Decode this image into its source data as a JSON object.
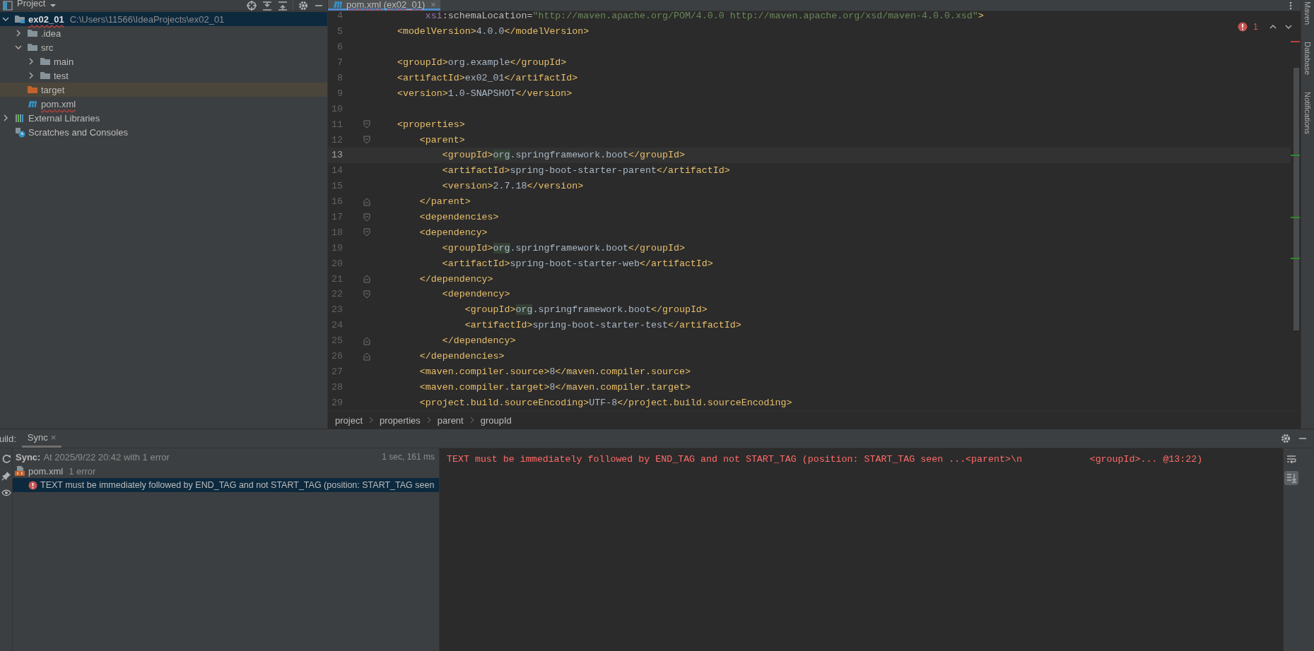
{
  "project_panel": {
    "title": "Project",
    "tree": [
      {
        "kind": "module",
        "label": "ex02_01",
        "path": "C:\\Users\\11566\\IdeaProjects\\ex02_01",
        "expanded": true,
        "selected": true,
        "highlighted": false,
        "has_error": true,
        "children": [
          {
            "kind": "folder",
            "label": ".idea",
            "expanded": false,
            "selected": false,
            "highlighted": false,
            "has_error": false
          },
          {
            "kind": "folder",
            "label": "src",
            "expanded": true,
            "selected": false,
            "highlighted": false,
            "has_error": false,
            "children": [
              {
                "kind": "folder",
                "label": "main",
                "expanded": false,
                "selected": false,
                "highlighted": false,
                "has_error": false
              },
              {
                "kind": "folder",
                "label": "test",
                "expanded": false,
                "selected": false,
                "highlighted": false,
                "has_error": false
              }
            ]
          },
          {
            "kind": "excluded",
            "label": "target",
            "selected": false,
            "highlighted": true,
            "has_error": false
          },
          {
            "kind": "maven",
            "label": "pom.xml",
            "selected": false,
            "highlighted": false,
            "has_error": true
          }
        ]
      },
      {
        "kind": "libraries",
        "label": "External Libraries",
        "expanded": false,
        "selected": false,
        "highlighted": false,
        "has_error": false
      },
      {
        "kind": "scratches",
        "label": "Scratches and Consoles",
        "selected": false,
        "highlighted": false,
        "has_error": false
      }
    ]
  },
  "editor": {
    "tabs": [
      {
        "label": "pom.xml (ex02_01)",
        "close": "×",
        "selected": true,
        "has_error": true
      }
    ],
    "error_count": "1",
    "lines": [
      {
        "number": "4",
        "current": false,
        "tokens": [
          {
            "kind": "ns",
            "text": "         xsi"
          },
          {
            "kind": "attr",
            "text": ":schemaLocation="
          },
          {
            "kind": "string",
            "text": "\"http://maven.apache.org/POM/4.0.0 http://maven.apache.org/xsd/maven-4.0.0.xsd\""
          },
          {
            "kind": "tag",
            "text": ">"
          }
        ]
      },
      {
        "number": "5",
        "current": false,
        "tokens": [
          {
            "kind": "tag",
            "text": "    <modelVersion>"
          },
          {
            "kind": "text",
            "text": "4.0.0"
          },
          {
            "kind": "tag",
            "text": "</modelVersion>"
          }
        ]
      },
      {
        "number": "6",
        "current": false
      },
      {
        "number": "7",
        "current": false,
        "tokens": [
          {
            "kind": "tag",
            "text": "    <groupId>"
          },
          {
            "kind": "text",
            "text": "org.example"
          },
          {
            "kind": "tag",
            "text": "</groupId>"
          }
        ]
      },
      {
        "number": "8",
        "current": false,
        "tokens": [
          {
            "kind": "tag",
            "text": "    <artifactId>"
          },
          {
            "kind": "text",
            "text": "ex02_01"
          },
          {
            "kind": "tag",
            "text": "</artifactId>"
          }
        ]
      },
      {
        "number": "9",
        "current": false,
        "tokens": [
          {
            "kind": "tag",
            "text": "    <version>"
          },
          {
            "kind": "text",
            "text": "1.0-SNAPSHOT"
          },
          {
            "kind": "tag",
            "text": "</version>"
          }
        ]
      },
      {
        "number": "10",
        "current": false
      },
      {
        "number": "11",
        "current": false,
        "kind": "fold-start",
        "tokens": [
          {
            "kind": "tag",
            "text": "    <properties>"
          }
        ]
      },
      {
        "number": "12",
        "current": false,
        "kind": "fold-start",
        "tokens": [
          {
            "kind": "tag",
            "text": "        <parent>"
          }
        ]
      },
      {
        "number": "13",
        "current": true,
        "tokens": [
          {
            "kind": "tag",
            "text": "            <groupId>"
          },
          {
            "kind": "match",
            "text": "org"
          },
          {
            "kind": "text",
            "text": ".springframework.boot"
          },
          {
            "kind": "tag",
            "text": "</groupId>"
          }
        ]
      },
      {
        "number": "14",
        "current": false,
        "tokens": [
          {
            "kind": "tag",
            "text": "            <artifactId>"
          },
          {
            "kind": "text",
            "text": "spring-boot-starter-parent"
          },
          {
            "kind": "tag",
            "text": "</artifactId>"
          }
        ]
      },
      {
        "number": "15",
        "current": false,
        "tokens": [
          {
            "kind": "tag",
            "text": "            <version>"
          },
          {
            "kind": "text",
            "text": "2.7.18"
          },
          {
            "kind": "tag",
            "text": "</version>"
          }
        ]
      },
      {
        "number": "16",
        "current": false,
        "kind": "fold-end",
        "tokens": [
          {
            "kind": "tag",
            "text": "        </parent>"
          }
        ]
      },
      {
        "number": "17",
        "current": false,
        "kind": "fold-start",
        "tokens": [
          {
            "kind": "tag",
            "text": "        <dependencies>"
          }
        ]
      },
      {
        "number": "18",
        "current": false,
        "kind": "fold-start",
        "tokens": [
          {
            "kind": "tag",
            "text": "        <dependency>"
          }
        ]
      },
      {
        "number": "19",
        "current": false,
        "tokens": [
          {
            "kind": "tag",
            "text": "            <groupId>"
          },
          {
            "kind": "match",
            "text": "org"
          },
          {
            "kind": "text",
            "text": ".springframework.boot"
          },
          {
            "kind": "tag",
            "text": "</groupId>"
          }
        ]
      },
      {
        "number": "20",
        "current": false,
        "tokens": [
          {
            "kind": "tag",
            "text": "            <artifactId>"
          },
          {
            "kind": "text",
            "text": "spring-boot-starter-web"
          },
          {
            "kind": "tag",
            "text": "</artifactId>"
          }
        ]
      },
      {
        "number": "21",
        "current": false,
        "kind": "fold-end",
        "tokens": [
          {
            "kind": "tag",
            "text": "        </dependency>"
          }
        ]
      },
      {
        "number": "22",
        "current": false,
        "kind": "fold-start",
        "tokens": [
          {
            "kind": "tag",
            "text": "            <dependency>"
          }
        ]
      },
      {
        "number": "23",
        "current": false,
        "tokens": [
          {
            "kind": "tag",
            "text": "                <groupId>"
          },
          {
            "kind": "match",
            "text": "org"
          },
          {
            "kind": "text",
            "text": ".springframework.boot"
          },
          {
            "kind": "tag",
            "text": "</groupId>"
          }
        ]
      },
      {
        "number": "24",
        "current": false,
        "tokens": [
          {
            "kind": "tag",
            "text": "                <artifactId>"
          },
          {
            "kind": "text",
            "text": "spring-boot-starter-test"
          },
          {
            "kind": "tag",
            "text": "</artifactId>"
          }
        ]
      },
      {
        "number": "25",
        "current": false,
        "kind": "fold-end",
        "tokens": [
          {
            "kind": "tag",
            "text": "            </dependency>"
          }
        ]
      },
      {
        "number": "26",
        "current": false,
        "kind": "fold-end",
        "tokens": [
          {
            "kind": "tag",
            "text": "        </dependencies>"
          }
        ]
      },
      {
        "number": "27",
        "current": false,
        "tokens": [
          {
            "kind": "tag",
            "text": "        <maven.compiler.source>"
          },
          {
            "kind": "text",
            "text": "8"
          },
          {
            "kind": "tag",
            "text": "</maven.compiler.source>"
          }
        ]
      },
      {
        "number": "28",
        "current": false,
        "tokens": [
          {
            "kind": "tag",
            "text": "        <maven.compiler.target>"
          },
          {
            "kind": "text",
            "text": "8"
          },
          {
            "kind": "tag",
            "text": "</maven.compiler.target>"
          }
        ]
      },
      {
        "number": "29",
        "current": false,
        "tokens": [
          {
            "kind": "tag",
            "text": "        <project.build.sourceEncoding>"
          },
          {
            "kind": "text",
            "text": "UTF-8"
          },
          {
            "kind": "tag",
            "text": "</project.build.sourceEncoding>"
          }
        ]
      }
    ],
    "breadcrumbs": [
      "project",
      "properties",
      "parent",
      "groupId"
    ]
  },
  "right_stripe": [
    "Maven",
    "Database",
    "Notifications"
  ],
  "build_panel": {
    "title": "uild:",
    "tabs": [
      {
        "label": "Sync",
        "close": "×",
        "selected": true
      }
    ],
    "rows": [
      {
        "kind": "summary",
        "label": "Sync:",
        "text": "At 2025/9/22 20:42 with 1 error",
        "duration": "1 sec, 161 ms",
        "selected": false
      },
      {
        "kind": "file",
        "label": "pom.xml",
        "text": "1 error",
        "selected": false
      },
      {
        "kind": "error",
        "text": "TEXT must be immediately followed by END_TAG and not START_TAG (position: START_TAG seen",
        "selected": true
      }
    ],
    "console": "TEXT must be immediately followed by END_TAG and not START_TAG (position: START_TAG seen ...<parent>\\n            <groupId>... @13:22)",
    "tools": [
      {
        "kind": "wrap",
        "selected": false
      },
      {
        "kind": "scroll-end",
        "selected": true
      }
    ]
  }
}
